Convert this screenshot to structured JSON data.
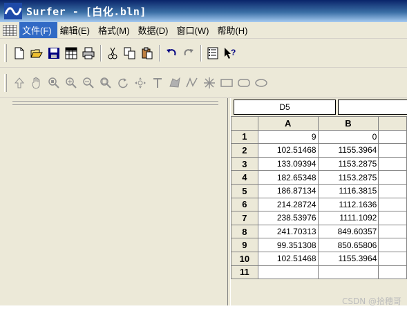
{
  "window": {
    "title": "Surfer - [白化.bln]"
  },
  "menu": {
    "items": [
      {
        "label": "文件(F)"
      },
      {
        "label": "编辑(E)"
      },
      {
        "label": "格式(M)"
      },
      {
        "label": "数据(D)"
      },
      {
        "label": "窗口(W)"
      },
      {
        "label": "帮助(H)"
      }
    ]
  },
  "toolbar1": {
    "icons": [
      "new-icon",
      "open-icon",
      "save-icon",
      "worksheet-icon",
      "print-icon",
      "cut-icon",
      "copy-icon",
      "paste-icon",
      "undo-icon",
      "redo-icon",
      "object-manager-icon",
      "context-help-icon"
    ]
  },
  "toolbar2": {
    "icons": [
      "select-arrow-icon",
      "pan-hand-icon",
      "zoom-actual-icon",
      "zoom-in-icon",
      "zoom-out-icon",
      "zoom-fit-icon",
      "rotate-icon",
      "tilt-icon",
      "text-icon",
      "polygon-icon",
      "polyline-icon",
      "symbol-icon",
      "rectangle-icon",
      "rounded-rectangle-icon",
      "ellipse-icon"
    ]
  },
  "sheet": {
    "active_cell": "D5",
    "columns": [
      "A",
      "B"
    ],
    "rows": [
      {
        "num": "1",
        "a": "9",
        "b": "0"
      },
      {
        "num": "2",
        "a": "102.51468",
        "b": "1155.3964"
      },
      {
        "num": "3",
        "a": "133.09394",
        "b": "1153.2875"
      },
      {
        "num": "4",
        "a": "182.65348",
        "b": "1153.2875"
      },
      {
        "num": "5",
        "a": "186.87134",
        "b": "1116.3815"
      },
      {
        "num": "6",
        "a": "214.28724",
        "b": "1112.1636"
      },
      {
        "num": "7",
        "a": "238.53976",
        "b": "1111.1092"
      },
      {
        "num": "8",
        "a": "241.70313",
        "b": "849.60357"
      },
      {
        "num": "9",
        "a": "99.351308",
        "b": "850.65806"
      },
      {
        "num": "10",
        "a": "102.51468",
        "b": "1155.3964"
      },
      {
        "num": "11",
        "a": "",
        "b": ""
      }
    ]
  },
  "watermark": "CSDN @拾穗哥"
}
